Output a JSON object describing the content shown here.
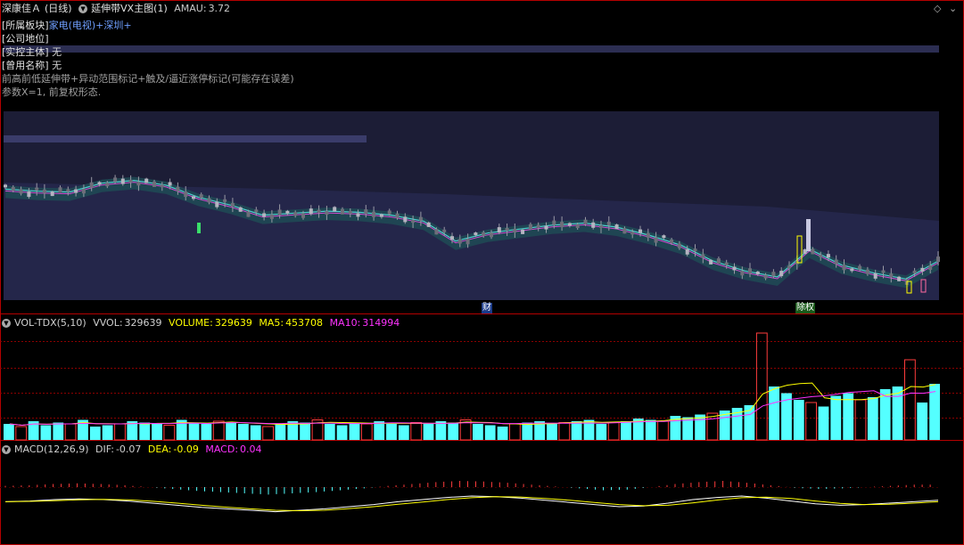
{
  "header": {
    "stock_name": "深康佳Ａ",
    "period": "(日线)",
    "indicator": "延伸带VX主图(1)",
    "amau_label": "AMAU:",
    "amau_value": "3.72"
  },
  "info": {
    "sector_label": "[所属板块]",
    "sector_value": "家电(电视)+深圳+",
    "position_label": "[公司地位]",
    "controller_label": "[实控主体]",
    "controller_value": "无",
    "former_name_label": "[曾用名称]",
    "former_name_value": "无",
    "note1": "前高前低延伸带+异动范围标记+触及/逼近涨停标记(可能存在误差)",
    "note2": "参数X=1, 前复权形态."
  },
  "markers": {
    "cai": "财",
    "ciquan": "除权"
  },
  "vol_header": {
    "name": "VOL-TDX(5,10)",
    "vvol_label": "VVOL:",
    "vvol_value": "329639",
    "volume_label": "VOLUME:",
    "volume_value": "329639",
    "ma5_label": "MA5:",
    "ma5_value": "453708",
    "ma10_label": "MA10:",
    "ma10_value": "314994"
  },
  "macd_header": {
    "name": "MACD(12,26,9)",
    "dif_label": "DIF:",
    "dif_value": "-0.07",
    "dea_label": "DEA:",
    "dea_value": "-0.09",
    "macd_label": "MACD:",
    "macd_value": "0.04"
  },
  "colors": {
    "up": "#ff3c3c",
    "down": "#54ffff",
    "white": "#e6e6e6",
    "yellow": "#ffff00",
    "magenta": "#ff32ff",
    "divider": "#b40000",
    "band": "#2a2c4e",
    "teal": "#4fd0d0"
  },
  "chart_data": {
    "type": "candlestick+volume+macd",
    "main_band_sample": [
      5.4,
      5.35,
      5.33,
      5.55,
      5.62,
      5.5,
      5.2,
      5.0,
      4.75,
      4.8,
      4.85,
      4.82,
      4.75,
      4.6,
      4.1,
      4.3,
      4.4,
      4.5,
      4.55,
      4.45,
      4.25,
      4.0,
      3.6,
      3.35,
      3.2,
      3.9,
      3.5,
      3.3,
      3.15,
      3.6
    ],
    "volume_sample": [
      12,
      10,
      14,
      11,
      13,
      12,
      15,
      10,
      11,
      12,
      14,
      13,
      12,
      11,
      15,
      13,
      12,
      14,
      13,
      12,
      11,
      10,
      12,
      14,
      13,
      15,
      12,
      11,
      13,
      12,
      14,
      12,
      11,
      13,
      12,
      14,
      13,
      15,
      12,
      11,
      10,
      12,
      13,
      14,
      12,
      13,
      14,
      15,
      12,
      13,
      14,
      16,
      15,
      14,
      18,
      17,
      19,
      20,
      22,
      24,
      26,
      80,
      40,
      35,
      30,
      28,
      25,
      33,
      35,
      30,
      32,
      38,
      40,
      60,
      28,
      42
    ],
    "macd_sample": [
      0.02,
      0.03,
      0.05,
      0.06,
      0.05,
      0.03,
      0.0,
      -0.03,
      -0.06,
      -0.08,
      -0.1,
      -0.12,
      -0.1,
      -0.08,
      -0.05,
      -0.02,
      0.02,
      0.05,
      0.08,
      0.1,
      0.09,
      0.07,
      0.04,
      0.01,
      -0.02,
      -0.05,
      -0.04,
      0.0,
      0.05,
      0.08,
      0.1,
      0.07,
      0.03,
      -0.01,
      -0.03,
      -0.02,
      0.0,
      0.02,
      0.04
    ]
  }
}
